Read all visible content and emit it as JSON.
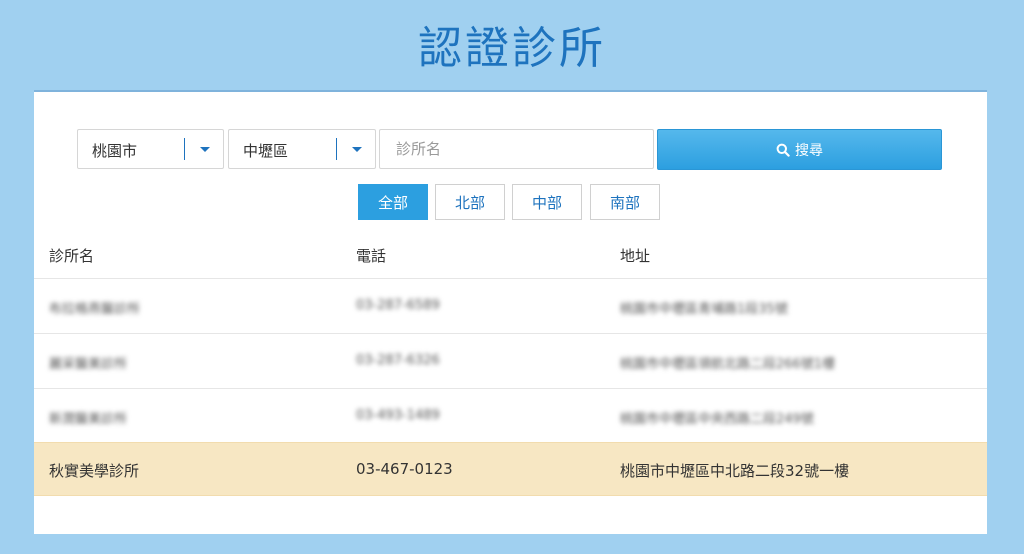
{
  "page_title": "認證診所",
  "search": {
    "city": "桃園市",
    "district": "中壢區",
    "name_placeholder": "診所名",
    "button_label": "搜尋"
  },
  "regions": [
    {
      "label": "全部",
      "active": true
    },
    {
      "label": "北部",
      "active": false
    },
    {
      "label": "中部",
      "active": false
    },
    {
      "label": "南部",
      "active": false
    }
  ],
  "table": {
    "headers": [
      "診所名",
      "電話",
      "地址"
    ],
    "rows": [
      {
        "name": "布拉格燕醫診所",
        "phone": "03-287-6589",
        "address": "桃園市中壢區青埔路1段35號",
        "blurred": true
      },
      {
        "name": "麗采醫美診所",
        "phone": "03-287-6326",
        "address": "桃園市中壢區領航北路二段266號1樓",
        "blurred": true
      },
      {
        "name": "新潤醫美診所",
        "phone": "03-493-1489",
        "address": "桃園市中壢區中央西路二段249號",
        "blurred": true
      },
      {
        "name": "秋實美學診所",
        "phone": "03-467-0123",
        "address": "桃園市中壢區中北路二段32號一樓",
        "blurred": false
      }
    ]
  },
  "colors": {
    "background": "#a0d0f0",
    "accent": "#1e73be",
    "button": "#2c9fe0",
    "highlight_row": "#f7e7c3"
  },
  "icons": [
    "chevron-down-icon",
    "search-icon"
  ]
}
